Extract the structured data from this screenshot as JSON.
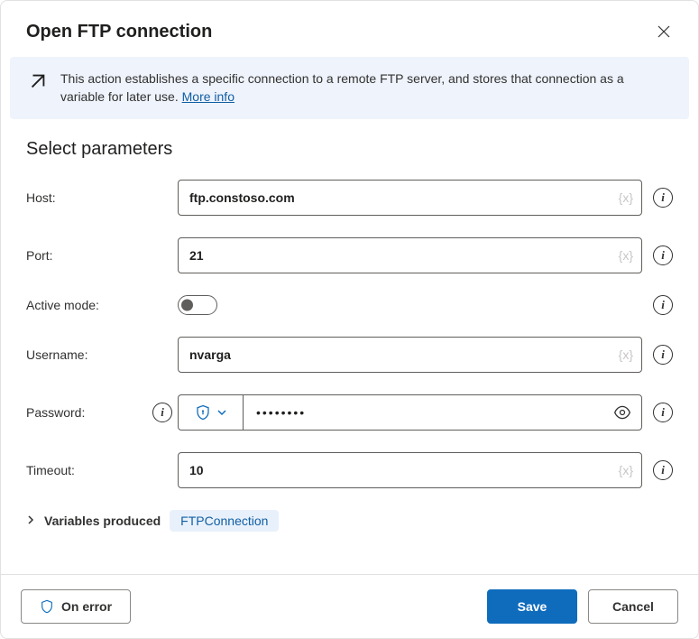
{
  "header": {
    "title": "Open FTP connection"
  },
  "banner": {
    "text": "This action establishes a specific connection to a remote FTP server, and stores that connection as a variable for later use.",
    "link_label": "More info"
  },
  "section_title": "Select parameters",
  "fields": {
    "host": {
      "label": "Host:",
      "value": "ftp.constoso.com"
    },
    "port": {
      "label": "Port:",
      "value": "21"
    },
    "active_mode": {
      "label": "Active mode:",
      "value": false
    },
    "username": {
      "label": "Username:",
      "value": "nvarga"
    },
    "password": {
      "label": "Password:",
      "value": "••••••••"
    },
    "timeout": {
      "label": "Timeout:",
      "value": "10"
    }
  },
  "var_placeholder": "{x}",
  "variables_produced": {
    "label": "Variables produced",
    "chip": "FTPConnection"
  },
  "footer": {
    "on_error": "On error",
    "save": "Save",
    "cancel": "Cancel"
  }
}
